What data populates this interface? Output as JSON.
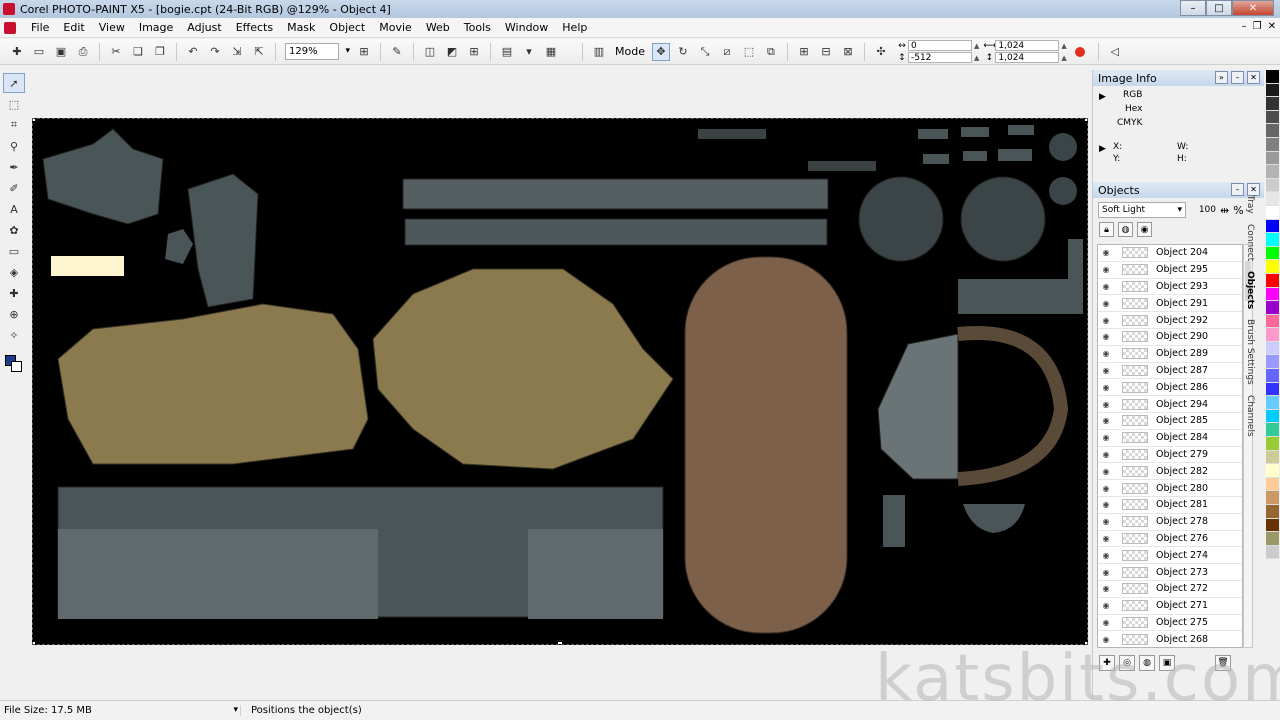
{
  "window": {
    "title": "Corel PHOTO-PAINT X5 - [bogie.cpt (24-Bit RGB) @129% - Object 4]"
  },
  "menu": [
    "File",
    "Edit",
    "View",
    "Image",
    "Adjust",
    "Effects",
    "Mask",
    "Object",
    "Movie",
    "Web",
    "Tools",
    "Window",
    "Help"
  ],
  "toolbar": {
    "zoom": "129%",
    "mode_label": "Mode",
    "x": "0",
    "y": "-512",
    "w": "1,024",
    "h": "1,024"
  },
  "image_info": {
    "title": "Image Info",
    "rgb": "RGB",
    "hex": "Hex",
    "cmyk": "CMYK",
    "x": "X:",
    "y": "Y:",
    "w": "W:",
    "h": "H:"
  },
  "objects_panel": {
    "title": "Objects",
    "blend_mode": "Soft Light",
    "opacity": "100",
    "opacity_unit": "%",
    "items": [
      "Object 204",
      "Object 295",
      "Object 293",
      "Object 291",
      "Object 292",
      "Object 290",
      "Object 289",
      "Object 287",
      "Object 286",
      "Object 294",
      "Object 285",
      "Object 284",
      "Object 279",
      "Object 282",
      "Object 280",
      "Object 281",
      "Object 278",
      "Object 276",
      "Object 274",
      "Object 273",
      "Object 272",
      "Object 271",
      "Object 275",
      "Object 268"
    ]
  },
  "docker_tabs": [
    "Tray",
    "Connect",
    "Objects",
    "Brush Settings",
    "Channels"
  ],
  "status": {
    "file_size": "File Size: 17.5 MB",
    "message": "Positions the object(s)"
  },
  "watermark": "katsbits.com",
  "palette": [
    "#000000",
    "#1a1a1a",
    "#333333",
    "#4d4d4d",
    "#666666",
    "#808080",
    "#999999",
    "#b3b3b3",
    "#cccccc",
    "#e6e6e6",
    "#ffffff",
    "#0000ff",
    "#00ffff",
    "#00ff00",
    "#ffff00",
    "#ff0000",
    "#ff00ff",
    "#9900cc",
    "#ff6699",
    "#ff99cc",
    "#ccccff",
    "#9999ff",
    "#6666ff",
    "#3333ff",
    "#66ccff",
    "#00ccff",
    "#33cc99",
    "#99cc33",
    "#cccc99",
    "#ffffcc",
    "#ffcc99",
    "#cc9966",
    "#996633",
    "#663300",
    "#999966",
    "#cccccc"
  ]
}
